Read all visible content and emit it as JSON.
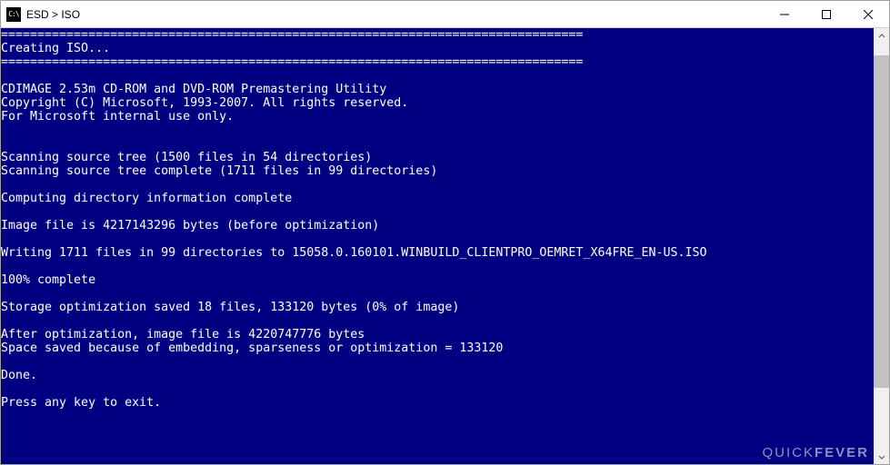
{
  "titlebar": {
    "icon_label": "C:\\",
    "title": "ESD > ISO"
  },
  "window_controls": {
    "minimize": "Minimize",
    "maximize": "Maximize",
    "close": "Close"
  },
  "console": {
    "lines": [
      "================================================================================",
      "Creating ISO...",
      "================================================================================",
      "",
      "CDIMAGE 2.53m CD-ROM and DVD-ROM Premastering Utility",
      "Copyright (C) Microsoft, 1993-2007. All rights reserved.",
      "For Microsoft internal use only.",
      "",
      "",
      "Scanning source tree (1500 files in 54 directories)",
      "Scanning source tree complete (1711 files in 99 directories)",
      "",
      "Computing directory information complete",
      "",
      "Image file is 4217143296 bytes (before optimization)",
      "",
      "Writing 1711 files in 99 directories to 15058.0.160101.WINBUILD_CLIENTPRO_OEMRET_X64FRE_EN-US.ISO",
      "",
      "100% complete",
      "",
      "Storage optimization saved 18 files, 133120 bytes (0% of image)",
      "",
      "After optimization, image file is 4220747776 bytes",
      "Space saved because of embedding, sparseness or optimization = 133120",
      "",
      "Done.",
      "",
      "Press any key to exit."
    ]
  },
  "scrollbar": {
    "thumb_top_pct": 3,
    "thumb_height_pct": 82
  },
  "watermark": {
    "part1": "QUICK",
    "part2": "FEVER"
  }
}
